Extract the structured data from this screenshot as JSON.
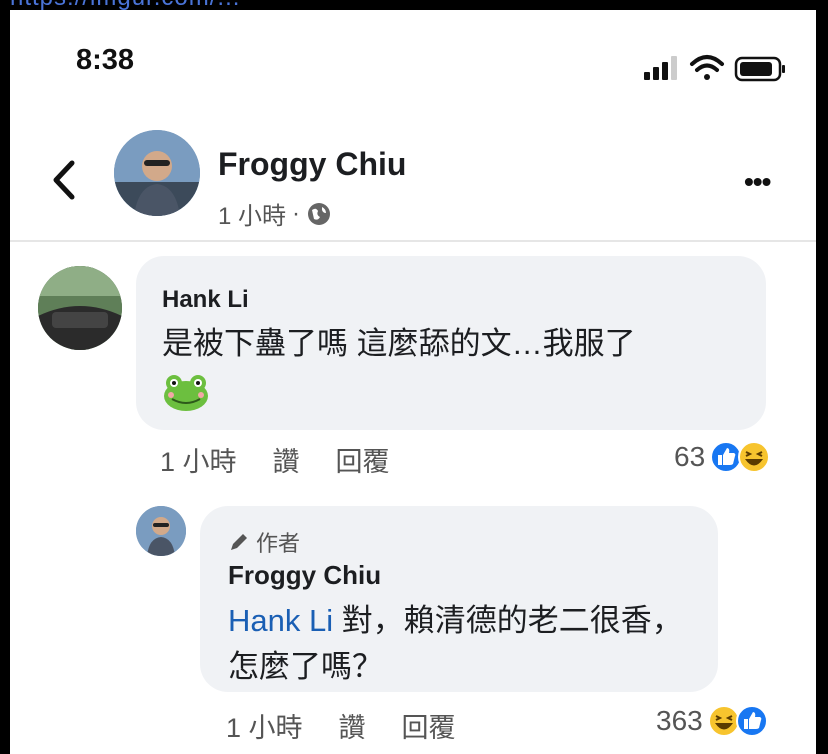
{
  "top_url_fragment": "https://imgur.com/...",
  "status_bar": {
    "time": "8:38"
  },
  "post_header": {
    "author": "Froggy Chiu",
    "time": "1 小時",
    "separator": "·",
    "privacy_icon": "globe-icon",
    "more_icon": "more-dots-icon",
    "back_icon": "chevron-left-icon"
  },
  "comments": [
    {
      "author": "Hank Li",
      "text": "是被下蠱了嗎 這麼舔的文…我服了",
      "emoji": "frog-emoji",
      "time": "1 小時",
      "like_label": "讚",
      "reply_label": "回覆",
      "reaction_count": "63",
      "reaction_icons": [
        "like-icon",
        "haha-icon"
      ]
    }
  ],
  "reply": {
    "author_badge": "作者",
    "author": "Froggy Chiu",
    "mention": "Hank Li",
    "text": " 對，賴清德的老二很香，怎麼了嗎？",
    "time": "1 小時",
    "like_label": "讚",
    "reply_label": "回覆",
    "reaction_count": "363",
    "reaction_icons": [
      "haha-icon",
      "like-icon"
    ]
  },
  "colors": {
    "bubble": "#f0f2f5",
    "link_blue": "#1a5fb4",
    "like_blue": "#1877f2",
    "haha_yellow": "#f7c42e"
  }
}
